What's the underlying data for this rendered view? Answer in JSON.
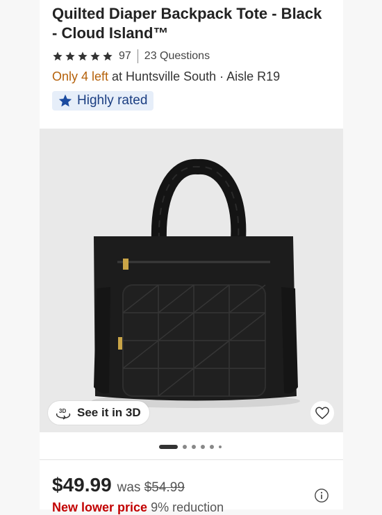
{
  "product": {
    "title": "Quilted Diaper Backpack Tote - Black - Cloud Island™",
    "rating_count": "97",
    "questions": "23 Questions",
    "stock_low": "Only 4 left",
    "stock_location": " at Huntsville South · Aisle R19",
    "badge_label": "Highly rated",
    "rating_value": 5
  },
  "image": {
    "view_3d_label": "See it in 3D",
    "carousel_count": 6,
    "carousel_active": 0
  },
  "pricing": {
    "price": "$49.99",
    "was_label": "was ",
    "was_price": "$54.99",
    "promo_label": "New lower price",
    "promo_detail": " 9% reduction"
  },
  "colors": {
    "low_stock": "#b5610a",
    "badge_bg": "#e6eef9",
    "badge_text": "#1b3e82",
    "promo": "#c20000"
  }
}
